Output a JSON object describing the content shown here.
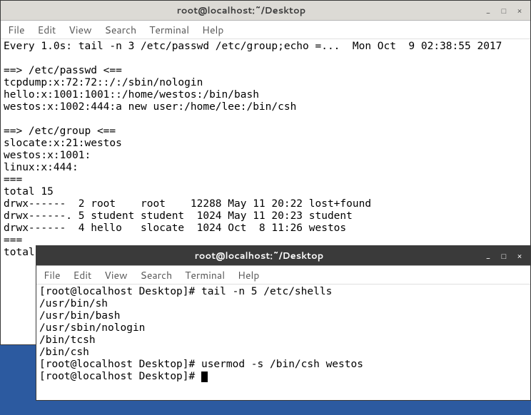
{
  "win1": {
    "title": "root@localhost:~/Desktop",
    "menu": [
      "File",
      "Edit",
      "View",
      "Search",
      "Terminal",
      "Help"
    ],
    "ctrl": {
      "min": "_",
      "max": "□",
      "close": "×"
    },
    "lines": [
      "Every 1.0s: tail -n 3 /etc/passwd /etc/group;echo =...  Mon Oct  9 02:38:55 2017",
      "",
      "==> /etc/passwd <==",
      "tcpdump:x:72:72::/:/sbin/nologin",
      "hello:x:1001:1001::/home/westos:/bin/bash",
      "westos:x:1002:444:a new user:/home/lee:/bin/csh",
      "",
      "==> /etc/group <==",
      "slocate:x:21:westos",
      "westos:x:1001:",
      "linux:x:444:",
      "===",
      "total 15",
      "drwx------  2 root    root    12288 May 11 20:22 lost+found",
      "drwx------. 5 student student  1024 May 11 20:23 student",
      "drwx------  4 hello   slocate  1024 Oct  8 11:26 westos",
      "===",
      "total"
    ]
  },
  "win2": {
    "title": "root@localhost:~/Desktop",
    "menu": [
      "File",
      "Edit",
      "View",
      "Search",
      "Terminal",
      "Help"
    ],
    "ctrl": {
      "min": "_",
      "max": "□",
      "close": "×"
    },
    "lines": [
      "[root@localhost Desktop]# tail -n 5 /etc/shells",
      "/usr/bin/sh",
      "/usr/bin/bash",
      "/usr/sbin/nologin",
      "/bin/tcsh",
      "/bin/csh",
      "[root@localhost Desktop]# usermod -s /bin/csh westos",
      "[root@localhost Desktop]# "
    ]
  }
}
